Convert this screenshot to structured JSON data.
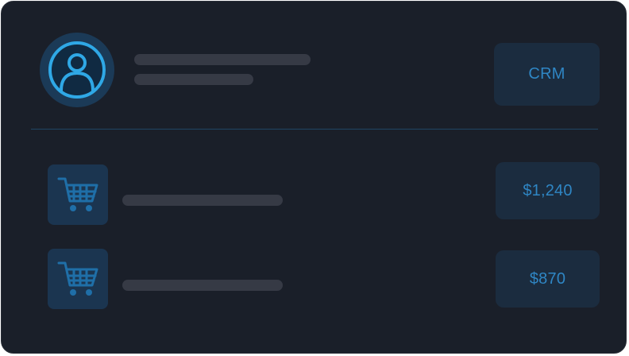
{
  "header": {
    "avatar_icon": "user-avatar-icon",
    "badge_label": "CRM"
  },
  "rows": [
    {
      "icon": "shopping-cart-icon",
      "amount": "$1,240"
    },
    {
      "icon": "shopping-cart-icon",
      "amount": "$870"
    }
  ],
  "colors": {
    "background": "#1a1f29",
    "accent": "#2f86c4",
    "avatar_ring": "#1b3a57",
    "tag_bg": "#1b2c3f",
    "skeleton": "#363a45",
    "divider": "#1f4564"
  }
}
